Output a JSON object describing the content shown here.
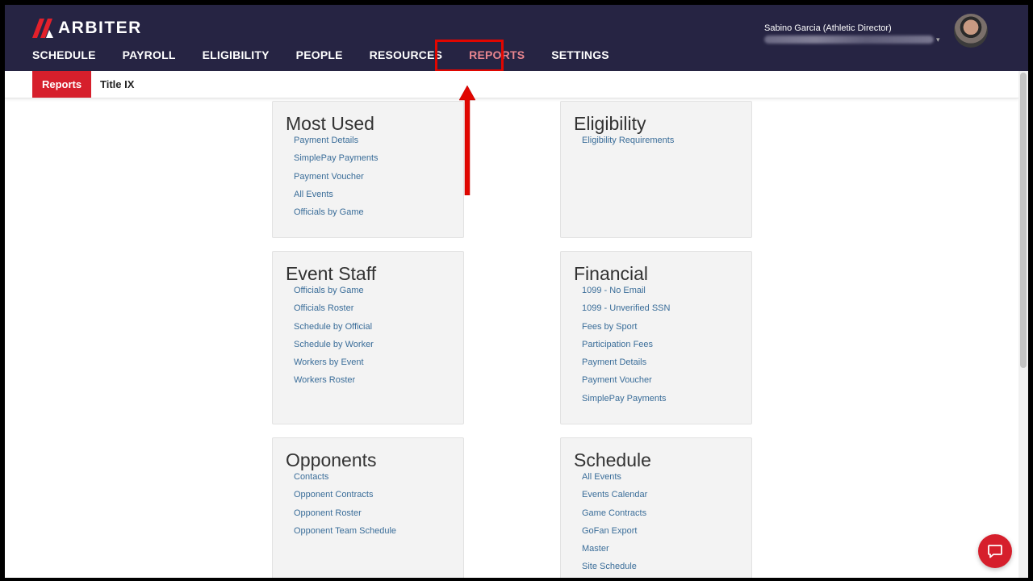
{
  "brand": {
    "name": "ARBITER",
    "accent": "#d61f2c",
    "header_bg": "#262443"
  },
  "user": {
    "name": "Sabino Garcia (Athletic Director)",
    "caret": "▾"
  },
  "nav": {
    "items": [
      {
        "label": "SCHEDULE",
        "key": "schedule"
      },
      {
        "label": "PAYROLL",
        "key": "payroll"
      },
      {
        "label": "ELIGIBILITY",
        "key": "eligibility"
      },
      {
        "label": "PEOPLE",
        "key": "people"
      },
      {
        "label": "RESOURCES",
        "key": "resources"
      },
      {
        "label": "REPORTS",
        "key": "reports",
        "active": true
      },
      {
        "label": "SETTINGS",
        "key": "settings"
      }
    ]
  },
  "subnav": {
    "tabs": [
      {
        "label": "Reports",
        "active": true
      },
      {
        "label": "Title IX"
      }
    ]
  },
  "sections": [
    {
      "title": "Most Used",
      "links": [
        "Payment Details",
        "SimplePay Payments",
        "Payment Voucher",
        "All Events",
        "Officials by Game"
      ]
    },
    {
      "title": "Eligibility",
      "links": [
        "Eligibility Requirements"
      ]
    },
    {
      "title": "Event Staff",
      "links": [
        "Officials by Game",
        "Officials Roster",
        "Schedule by Official",
        "Schedule by Worker",
        "Workers by Event",
        "Workers Roster"
      ]
    },
    {
      "title": "Financial",
      "links": [
        "1099 - No Email",
        "1099 - Unverified SSN",
        "Fees by Sport",
        "Participation Fees",
        "Payment Details",
        "Payment Voucher",
        "SimplePay Payments"
      ]
    },
    {
      "title": "Opponents",
      "links": [
        "Contacts",
        "Opponent Contracts",
        "Opponent Roster",
        "Opponent Team Schedule"
      ]
    },
    {
      "title": "Schedule",
      "links": [
        "All Events",
        "Events Calendar",
        "Game Contracts",
        "GoFan Export",
        "Master",
        "Site Schedule"
      ]
    }
  ],
  "icons": {
    "logo": "arbiter-logo-icon",
    "chat": "chat-bubble-icon",
    "arrow": "red-arrow-annotation"
  }
}
